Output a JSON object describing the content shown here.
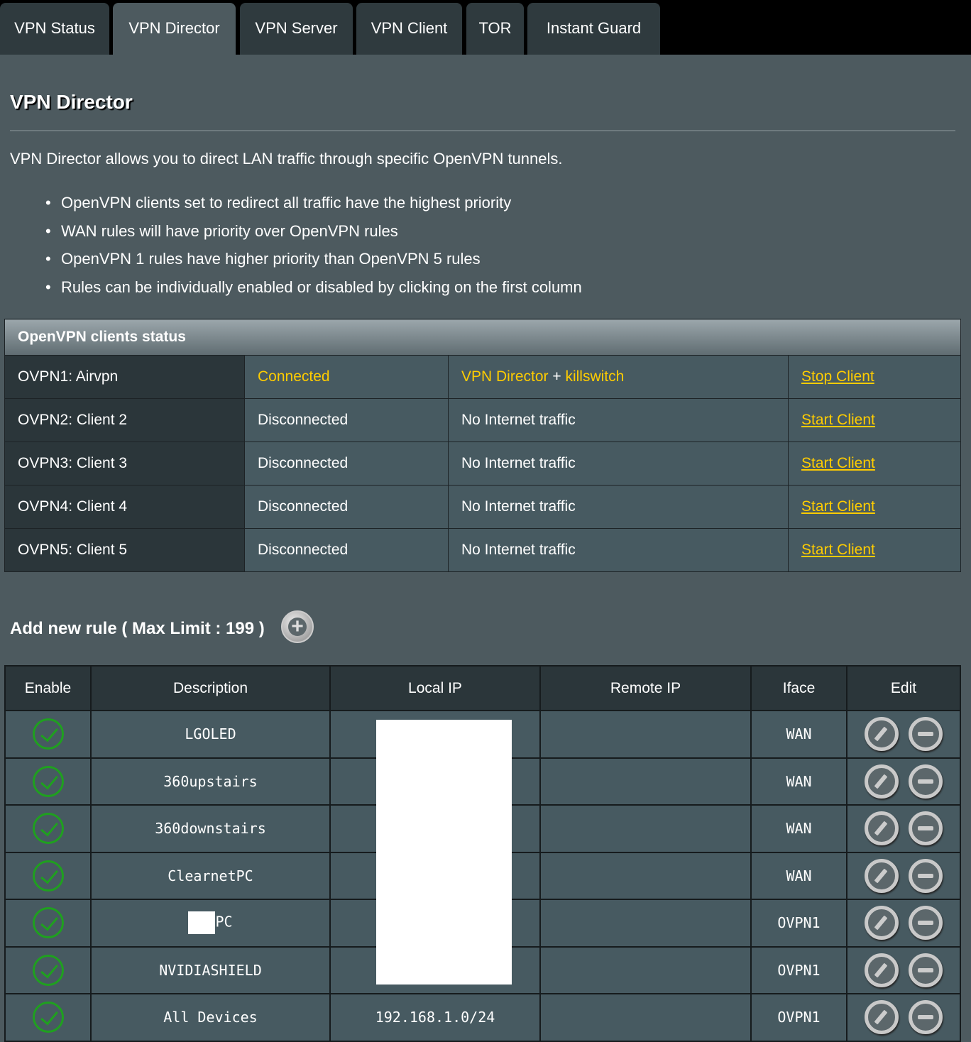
{
  "tabs": [
    {
      "label": "VPN Status"
    },
    {
      "label": "VPN Director",
      "active": true
    },
    {
      "label": "VPN Server"
    },
    {
      "label": "VPN Client"
    },
    {
      "label": "TOR"
    },
    {
      "label": "Instant Guard"
    }
  ],
  "title": "VPN Director",
  "intro": "VPN Director allows you to direct LAN traffic through specific OpenVPN tunnels.",
  "bullets": [
    "OpenVPN clients set to redirect all traffic have the highest priority",
    "WAN rules will have priority over OpenVPN rules",
    "OpenVPN 1 rules have higher priority than OpenVPN 5 rules",
    "Rules can be individually enabled or disabled by clicking on the first column"
  ],
  "status": {
    "header": "OpenVPN clients status",
    "rows": [
      {
        "name": "OVPN1: Airvpn",
        "state": "Connected",
        "mode": "VPN Director",
        "plus": " + ",
        "mode2": "killswitch",
        "action": "Stop Client",
        "active": true
      },
      {
        "name": "OVPN2: Client 2",
        "state": "Disconnected",
        "mode": "No Internet traffic",
        "action": "Start Client"
      },
      {
        "name": "OVPN3: Client 3",
        "state": "Disconnected",
        "mode": "No Internet traffic",
        "action": "Start Client"
      },
      {
        "name": "OVPN4: Client 4",
        "state": "Disconnected",
        "mode": "No Internet traffic",
        "action": "Start Client"
      },
      {
        "name": "OVPN5: Client 5",
        "state": "Disconnected",
        "mode": "No Internet traffic",
        "action": "Start Client"
      }
    ]
  },
  "add_rule": {
    "label": "Add new rule ( Max Limit : 199 )",
    "icon": "plus-circle-icon",
    "plus": "+"
  },
  "rules": {
    "columns": [
      "Enable",
      "Description",
      "Local IP",
      "Remote IP",
      "Iface",
      "Edit"
    ],
    "rows": [
      {
        "enabled": true,
        "description": "LGOLED",
        "local_ip": "",
        "remote_ip": "",
        "iface": "WAN"
      },
      {
        "enabled": true,
        "description": "360upstairs",
        "local_ip": "",
        "remote_ip": "",
        "iface": "WAN"
      },
      {
        "enabled": true,
        "description": "360downstairs",
        "local_ip": "",
        "remote_ip": "",
        "iface": "WAN"
      },
      {
        "enabled": true,
        "description": "ClearnetPC",
        "local_ip": "",
        "remote_ip": "",
        "iface": "WAN"
      },
      {
        "enabled": true,
        "description": "PC",
        "redacted": true,
        "local_ip": "",
        "remote_ip": "",
        "iface": "OVPN1"
      },
      {
        "enabled": true,
        "description": "NVIDIASHIELD",
        "local_ip": "",
        "remote_ip": "",
        "iface": "OVPN1"
      },
      {
        "enabled": true,
        "description": "All Devices",
        "local_ip": "192.168.1.0/24",
        "remote_ip": "",
        "iface": "OVPN1"
      }
    ]
  },
  "colors": {
    "accent": "#ffcc00",
    "enabled": "#1fa01f",
    "background": "#4d5a5f"
  }
}
